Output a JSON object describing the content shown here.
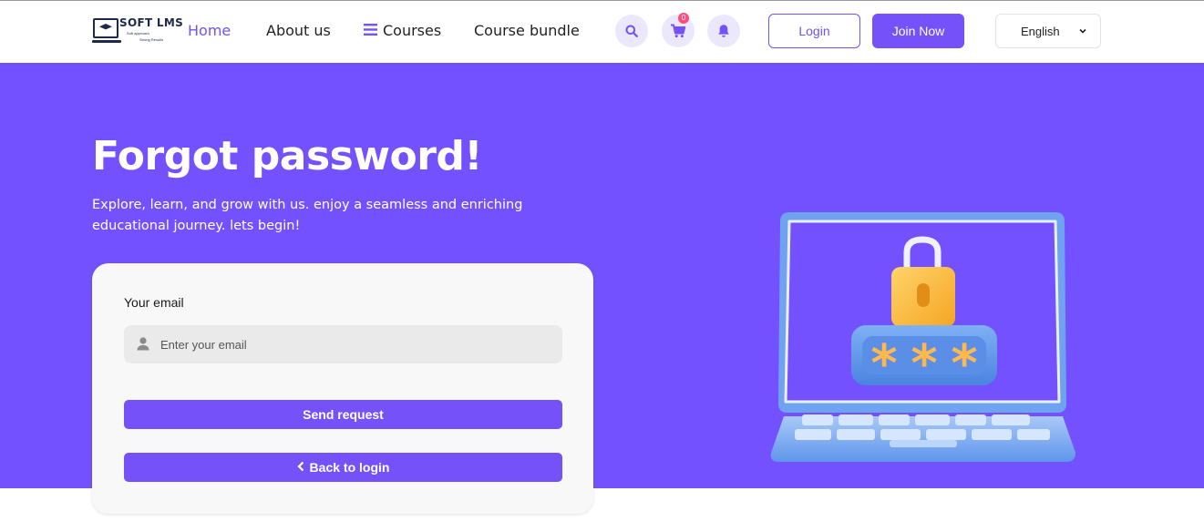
{
  "brand": {
    "name": "SOFT LMS",
    "tagline": "Soft approach",
    "tagline2": "Strong Results"
  },
  "nav": {
    "home": "Home",
    "about": "About us",
    "courses": "Courses",
    "bundle": "Course bundle"
  },
  "cart": {
    "count": "0"
  },
  "auth": {
    "login": "Login",
    "join": "Join Now"
  },
  "language": {
    "selected": "English"
  },
  "hero": {
    "title": "Forgot password!",
    "subtitle": "Explore, learn, and grow with us. enjoy a seamless and enriching educational journey. lets begin!"
  },
  "form": {
    "email_label": "Your email",
    "email_placeholder": "Enter your email",
    "email_value": "",
    "send_label": "Send request",
    "back_label": "Back to login"
  },
  "colors": {
    "accent": "#7451f8",
    "hero_bg": "#7451ff",
    "badge": "#ff4d7d"
  },
  "icons": {
    "search": "search-icon",
    "cart": "cart-icon",
    "bell": "bell-icon",
    "menu": "menu-icon",
    "user": "user-icon",
    "chevron_down": "chevron-down-icon",
    "chevron_left": "chevron-left-icon"
  }
}
